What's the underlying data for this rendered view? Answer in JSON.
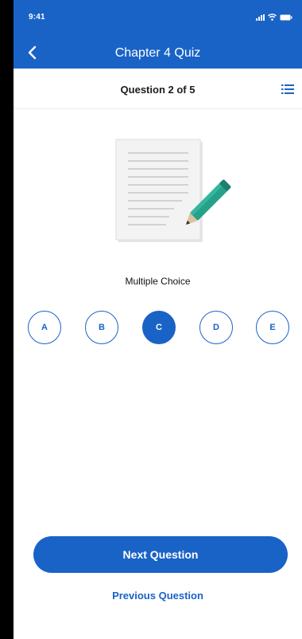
{
  "status_bar": {
    "time": "9:41"
  },
  "app_bar": {
    "title": "Chapter 4 Quiz"
  },
  "question_bar": {
    "counter": "Question 2 of 5"
  },
  "question": {
    "type": "Multiple Choice",
    "options": [
      "A",
      "B",
      "C",
      "D",
      "E"
    ],
    "selected": "C"
  },
  "footer": {
    "next_label": "Next Question",
    "previous_label": "Previous Question"
  },
  "colors": {
    "primary": "#1a63c6",
    "illustration_pencil": "#27a08a"
  },
  "icons": {
    "back": "chevron-left-icon",
    "question_list": "list-icon",
    "illustration": "document-pencil-icon"
  }
}
